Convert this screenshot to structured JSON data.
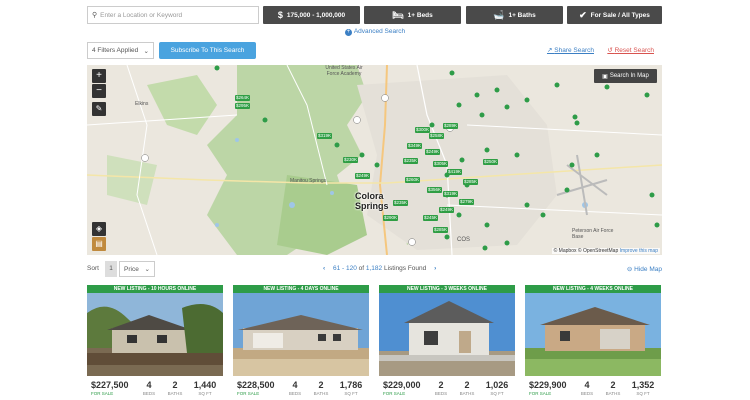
{
  "search": {
    "placeholder": "Enter a Location or Keyword"
  },
  "filters": {
    "price": "175,000 - 1,000,000",
    "beds": "1+ Beds",
    "baths": "1+ Baths",
    "status": "For Sale / All Types"
  },
  "advanced_search": "Advanced Search",
  "filters_applied": "4 Filters Applied",
  "subscribe": "Subscribe To This Search",
  "share": "Share Search",
  "reset": "Reset Search",
  "map": {
    "search_in_map": "Search In Map",
    "zoom_in": "+",
    "zoom_out": "−",
    "city": "Colorado Springs",
    "city_line1": "Colora",
    "city_line2": "Springs",
    "academy": "United States Air Force Academy",
    "air_force_base": "Peterson Air Force Base",
    "manitou": "Manitou Springs",
    "woodland": "Elkins",
    "cos": "COS",
    "attribution_mapbox": "© Mapbox",
    "attribution_osm": "© OpenStreetMap",
    "attribution_improve": "Improve this map",
    "price_tags": [
      "$264K",
      "$295K",
      "$319K",
      "$230K",
      "$249K",
      "$349K",
      "$258K",
      "$289K",
      "$300K",
      "$249K",
      "$235K",
      "$305K",
      "$419K",
      "$285K",
      "$260K",
      "$356K",
      "$319K",
      "$279K",
      "$249K",
      "$245K",
      "$285K",
      "$290K",
      "$235K",
      "$250K"
    ]
  },
  "results": {
    "sort_label": "Sort",
    "sort_value": "1",
    "sort_by": "Price",
    "range": "61 - 120",
    "of_text": "of",
    "total": "1,182",
    "listings_found": "Listings Found",
    "hide_map": "Hide Map"
  },
  "listings": [
    {
      "banner": "NEW LISTING - 10 HOURS ONLINE",
      "price": "$227,500",
      "status": "FOR SALE",
      "beds": "4",
      "baths": "2",
      "sqft": "1,440"
    },
    {
      "banner": "NEW LISTING - 4 DAYS ONLINE",
      "price": "$228,500",
      "status": "FOR SALE",
      "beds": "4",
      "baths": "2",
      "sqft": "1,786"
    },
    {
      "banner": "NEW LISTING - 3 WEEKS ONLINE",
      "price": "$229,000",
      "status": "FOR SALE",
      "beds": "2",
      "baths": "2",
      "sqft": "1,026"
    },
    {
      "banner": "NEW LISTING - 4 WEEKS ONLINE",
      "price": "$229,900",
      "status": "FOR SALE",
      "beds": "4",
      "baths": "2",
      "sqft": "1,352"
    }
  ],
  "units": {
    "beds": "BEDS",
    "baths": "BATHS",
    "sqft": "SQ FT"
  },
  "colors": {
    "brand_green": "#2e9c48",
    "accent_blue": "#4aa3df",
    "filter_dark": "#4a4a4a",
    "reset_red": "#d9534f"
  }
}
